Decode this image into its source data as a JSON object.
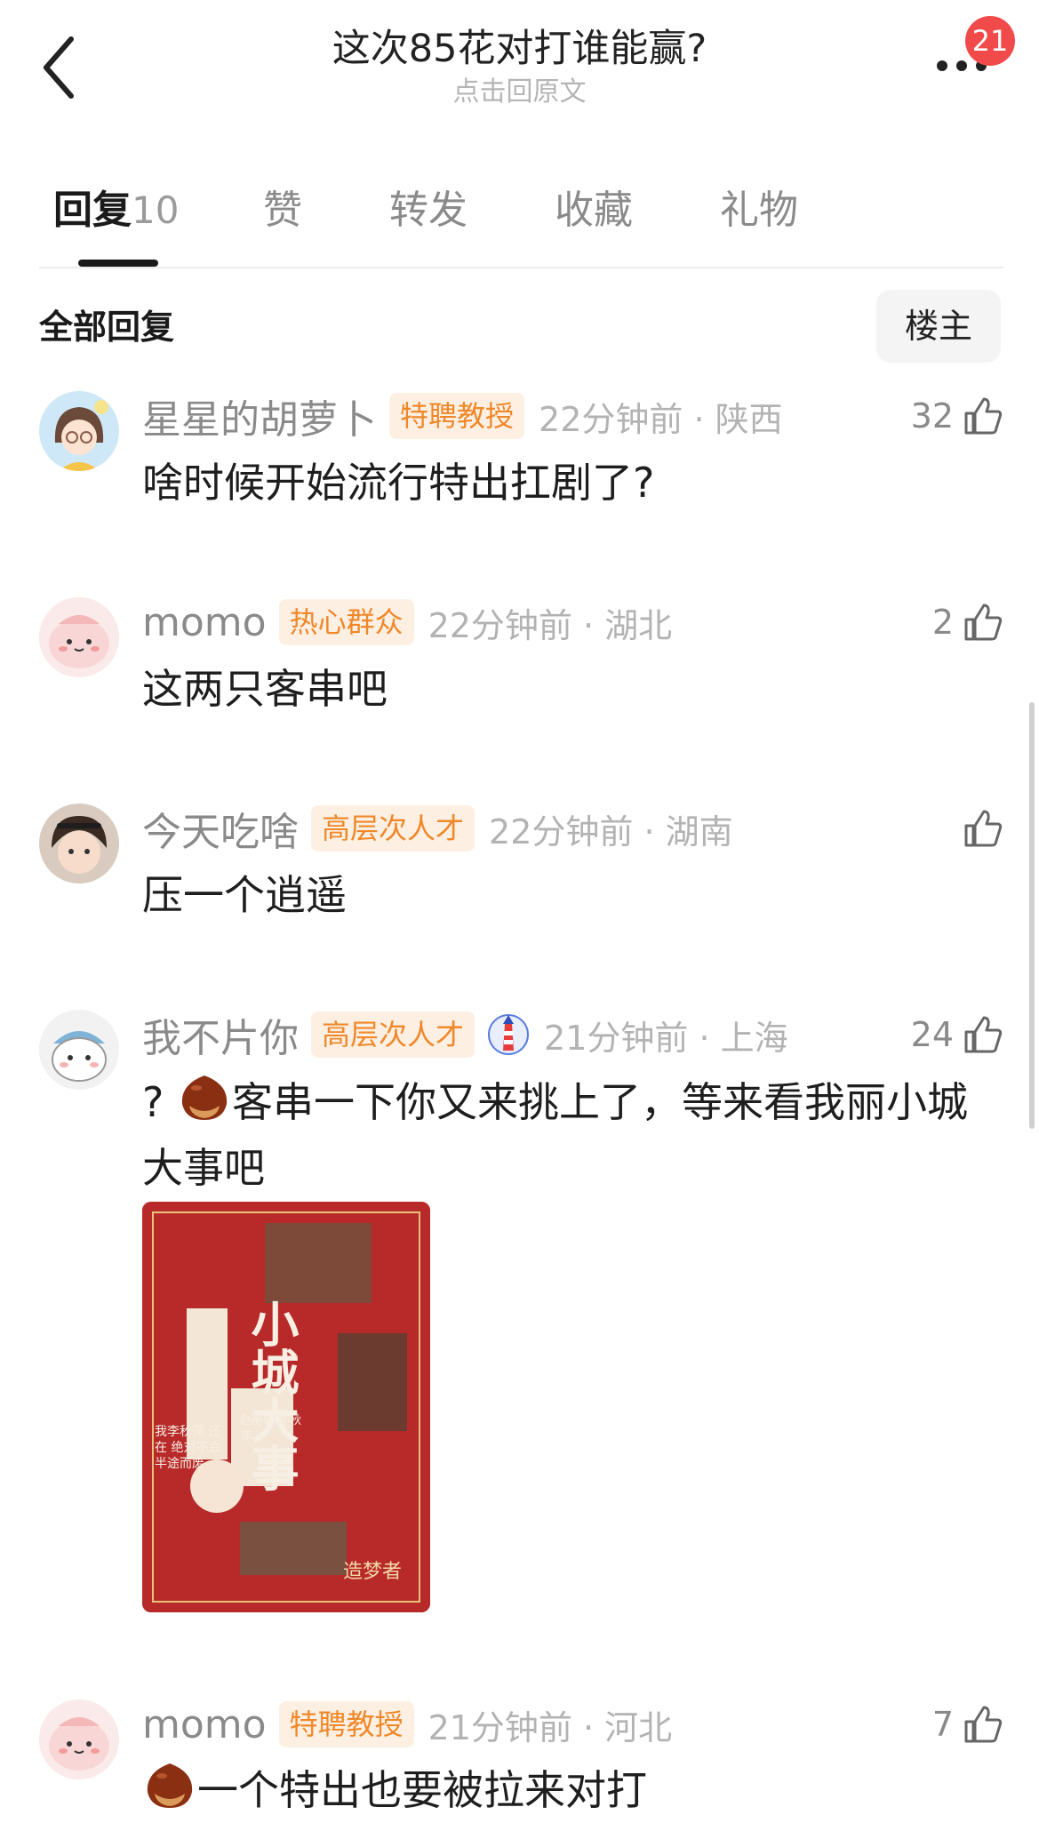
{
  "header": {
    "title": "这次85花对打谁能赢?",
    "subtitle": "点击回原文",
    "notification_count": "21"
  },
  "tabs": [
    {
      "label": "回复",
      "count": "10"
    },
    {
      "label": "赞"
    },
    {
      "label": "转发"
    },
    {
      "label": "收藏"
    },
    {
      "label": "礼物"
    }
  ],
  "section": {
    "title": "全部回复",
    "owner_filter": "楼主"
  },
  "comments": [
    {
      "user": "星星的胡萝卜",
      "tag": "特聘教授",
      "time": "22分钟前 · 陕西",
      "likes": "32",
      "text": "啥时候开始流行特出扛剧了?"
    },
    {
      "user": "momo",
      "tag": "热心群众",
      "time": "22分钟前 · 湖北",
      "likes": "2",
      "text": "这两只客串吧"
    },
    {
      "user": "今天吃啥",
      "tag": "高层次人才",
      "time": "22分钟前 · 湖南",
      "likes": "",
      "text": "压一个逍遥"
    },
    {
      "user": "我不片你",
      "tag": "高层次人才",
      "time": "21分钟前 · 上海",
      "likes": "24",
      "text_before": "?",
      "text": "客串一下你又来挑上了，等来看我丽小城大事吧"
    },
    {
      "user": "momo",
      "tag": "特聘教授",
      "time": "21分钟前 · 河北",
      "likes": "7",
      "text": "一个特出也要被拉来对打"
    }
  ],
  "poster": {
    "title_chars": "小城大事",
    "slogan": "造梦者",
    "names": "赵丽颖 李秋萍",
    "tagline": "我李秋萍 还在 绝对不会 半途而废"
  },
  "colors": {
    "accent_tag_bg": "#fdf0e3",
    "accent_tag_text": "#f0882a",
    "badge": "#f04a4a",
    "poster_red": "#b82a2a"
  }
}
